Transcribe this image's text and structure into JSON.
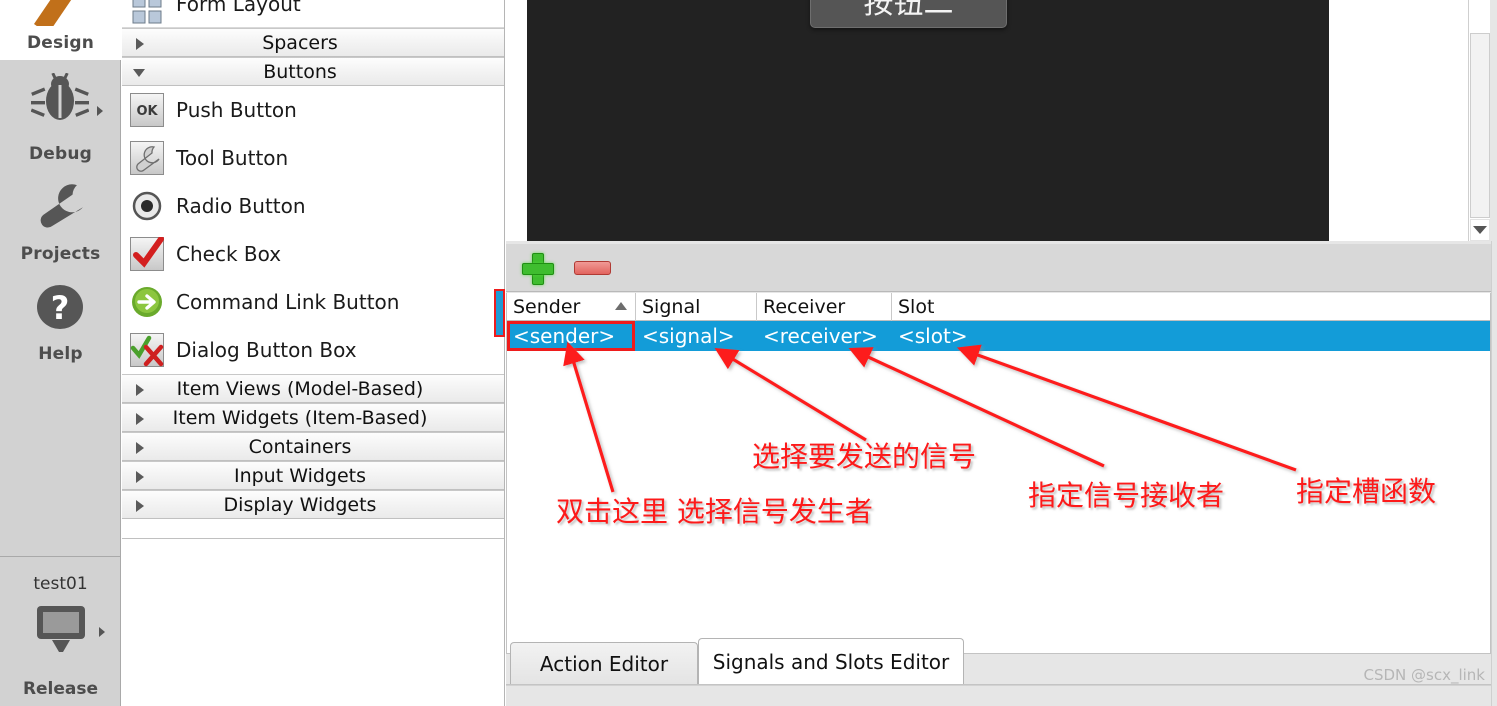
{
  "modebar": {
    "items": [
      {
        "label": "Design",
        "icon": "pencil-icon",
        "active": true,
        "has_submenu": false
      },
      {
        "label": "Debug",
        "icon": "bug-icon",
        "active": false,
        "has_submenu": true
      },
      {
        "label": "Projects",
        "icon": "wrench-icon",
        "active": false,
        "has_submenu": false
      },
      {
        "label": "Help",
        "icon": "question-mark-icon",
        "active": false,
        "has_submenu": false
      }
    ],
    "kit": {
      "project_name": "test01",
      "build_config": "Release",
      "icon": "monitor-icon",
      "has_submenu": true
    }
  },
  "widget_box": {
    "rows": [
      {
        "kind": "widget",
        "label": "Form Layout",
        "icon": "form-layout-icon"
      },
      {
        "kind": "category",
        "label": "Spacers",
        "expanded": false
      },
      {
        "kind": "category",
        "label": "Buttons",
        "expanded": true
      },
      {
        "kind": "widget",
        "label": "Push Button",
        "icon": "push-button-icon"
      },
      {
        "kind": "widget",
        "label": "Tool Button",
        "icon": "tool-button-icon"
      },
      {
        "kind": "widget",
        "label": "Radio Button",
        "icon": "radio-button-icon"
      },
      {
        "kind": "widget",
        "label": "Check Box",
        "icon": "check-box-icon"
      },
      {
        "kind": "widget",
        "label": "Command Link Button",
        "icon": "command-link-icon"
      },
      {
        "kind": "widget",
        "label": "Dialog Button Box",
        "icon": "dialog-button-box-icon"
      },
      {
        "kind": "category",
        "label": "Item Views (Model-Based)",
        "expanded": false
      },
      {
        "kind": "category",
        "label": "Item Widgets (Item-Based)",
        "expanded": false
      },
      {
        "kind": "category",
        "label": "Containers",
        "expanded": false
      },
      {
        "kind": "category",
        "label": "Input Widgets",
        "expanded": false
      },
      {
        "kind": "category",
        "label": "Display Widgets",
        "expanded": false
      }
    ]
  },
  "form_preview": {
    "button_label": "按钮二",
    "background_color": "#222222",
    "scrollbar": {
      "down_arrow_icon": "chevron-down-icon"
    }
  },
  "signals_slots_editor": {
    "toolbar": {
      "add_label": "",
      "add_icon": "plus-icon",
      "remove_label": "",
      "remove_icon": "minus-icon"
    },
    "columns": [
      {
        "label": "Sender",
        "sort": "ascending"
      },
      {
        "label": "Signal",
        "sort": ""
      },
      {
        "label": "Receiver",
        "sort": ""
      },
      {
        "label": "Slot",
        "sort": ""
      }
    ],
    "rows": [
      {
        "sender": "<sender>",
        "signal": "<signal>",
        "receiver": "<receiver>",
        "slot": "<slot>",
        "selected": true
      }
    ],
    "selection_color": "#139cd8",
    "tabs": [
      {
        "label": "Action Editor",
        "active": false
      },
      {
        "label": "Signals and Slots Editor",
        "active": true
      }
    ]
  },
  "annotations": {
    "highlight_color": "#fd1a1a",
    "items": [
      {
        "text": "双击这里 选择信号发生者",
        "target": "sender-cell"
      },
      {
        "text": "选择要发送的信号",
        "target": "signal-cell"
      },
      {
        "text": "指定信号接收者",
        "target": "receiver-cell"
      },
      {
        "text": "指定槽函数",
        "target": "slot-cell"
      }
    ]
  },
  "watermark": {
    "text": "CSDN @scx_link"
  }
}
